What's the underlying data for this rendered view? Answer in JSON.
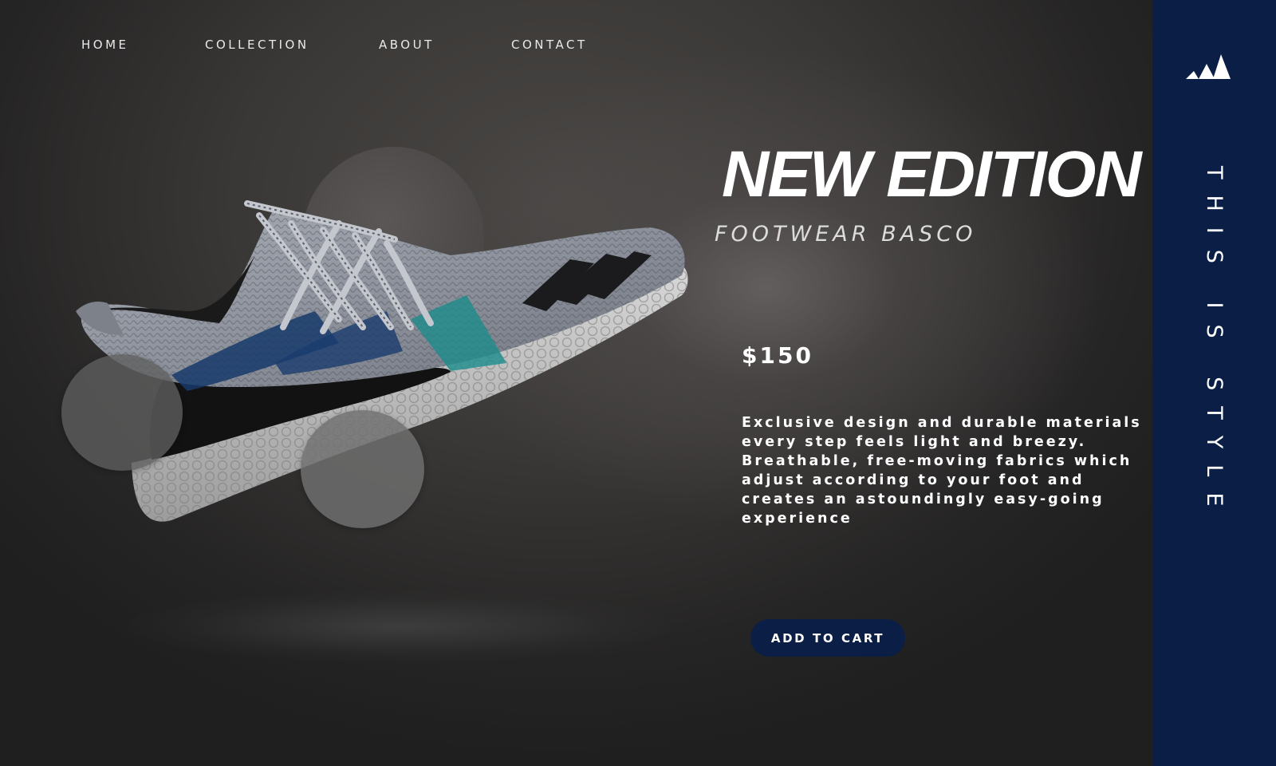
{
  "nav": {
    "items": [
      {
        "label": "HOME"
      },
      {
        "label": "COLLECTION"
      },
      {
        "label": "ABOUT"
      },
      {
        "label": "CONTACT"
      }
    ]
  },
  "hero": {
    "title": "NEW EDITION",
    "subtitle": "FOOTWEAR BASCO",
    "price": "$150",
    "description": "Exclusive design and durable materials every step feels light and breezy. Breathable, free-moving fabrics which adjust according to your foot and creates an astoundingly easy-going experience",
    "cta_label": "ADD TO CART"
  },
  "side_panel": {
    "logo_icon": "three-stripes-logo-icon",
    "tagline": "THIS IS STYLE"
  },
  "colors": {
    "accent_navy": "#0b1f46",
    "text_white": "#ffffff",
    "background_dark": "#2a2828"
  }
}
